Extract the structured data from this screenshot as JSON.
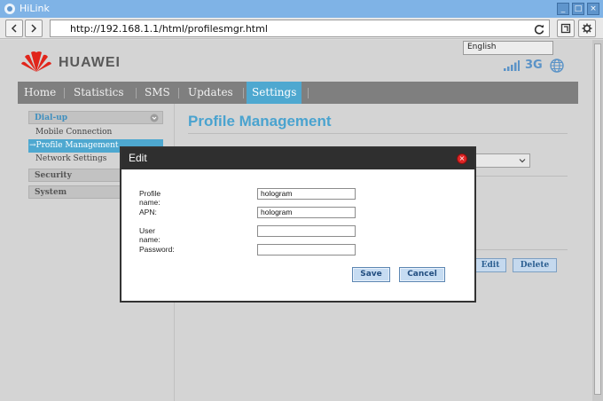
{
  "window": {
    "title": "HiLink",
    "buttons": [
      "_",
      "□",
      "×"
    ]
  },
  "browser": {
    "url": "http://192.168.1.1/html/profilesmgr.html"
  },
  "header": {
    "brand": "HUAWEI",
    "language": "English",
    "network": "3G"
  },
  "nav": {
    "items": [
      "Home",
      "Statistics",
      "SMS",
      "Updates",
      "Settings"
    ],
    "active": "Settings"
  },
  "sidebar": {
    "dialup": "Dial-up",
    "items": [
      "Mobile Connection",
      "→Profile Management",
      "Network Settings"
    ],
    "security": "Security",
    "system": "System"
  },
  "main": {
    "title": "Profile Management",
    "edit_label": "Edit",
    "delete_label": "Delete"
  },
  "dialog": {
    "title": "Edit",
    "close_label": "×",
    "fields": [
      {
        "label": "Profile name:",
        "value": "hologram"
      },
      {
        "label": "APN:",
        "value": "hologram"
      },
      {
        "label": "User name:",
        "value": ""
      },
      {
        "label": "Password:",
        "value": ""
      }
    ],
    "save_label": "Save",
    "cancel_label": "Cancel"
  },
  "colors": {
    "accent": "#4ea8d0",
    "title_bar": "#7fb3e6",
    "nav_bar": "#7f7f7f",
    "dialog_header": "#2f2f2f"
  }
}
